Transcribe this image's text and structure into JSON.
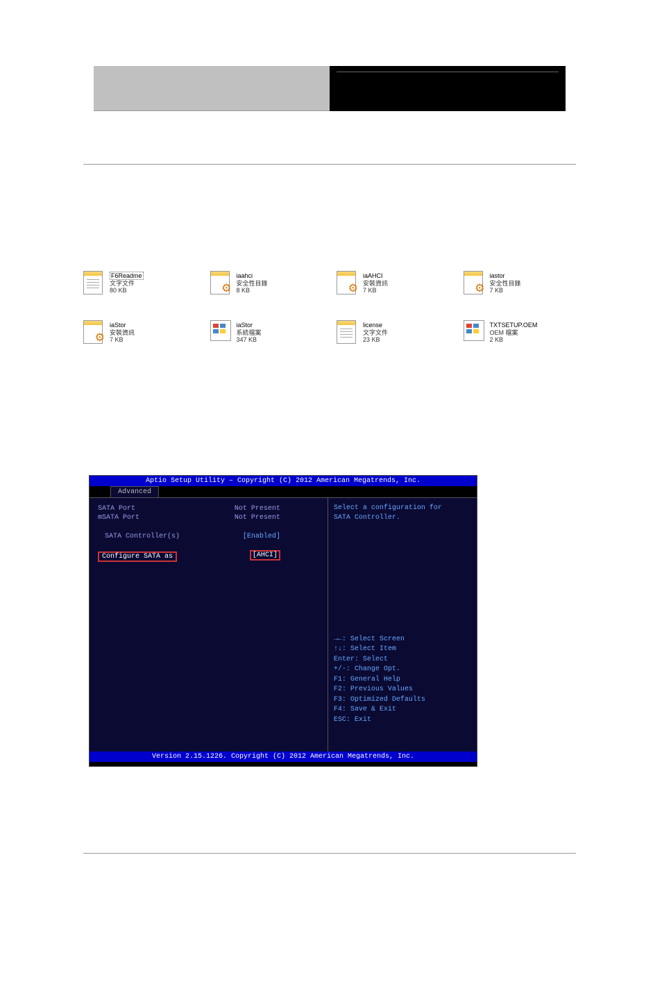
{
  "files": [
    {
      "name": "F6Readme",
      "type": "文字文件",
      "size": "80 KB",
      "icon": "text",
      "selected": true
    },
    {
      "name": "iaahci",
      "type": "安全性目錄",
      "size": "8 KB",
      "icon": "gear"
    },
    {
      "name": "iaAHCI",
      "type": "安裝資訊",
      "size": "7 KB",
      "icon": "text"
    },
    {
      "name": "iastor",
      "type": "安全性目錄",
      "size": "7 KB",
      "icon": "gear"
    },
    {
      "name": "iaStor",
      "type": "安裝資訊",
      "size": "7 KB",
      "icon": "gear"
    },
    {
      "name": "iaStor",
      "type": "系統檔案",
      "size": "347 KB",
      "icon": "sys"
    },
    {
      "name": "license",
      "type": "文字文件",
      "size": "23 KB",
      "icon": "text"
    },
    {
      "name": "TXTSETUP.OEM",
      "type": "OEM 檔案",
      "size": "2 KB",
      "icon": "sys"
    }
  ],
  "bios": {
    "header": "Aptio Setup Utility – Copyright (C) 2012 American Megatrends, Inc.",
    "tab": "Advanced",
    "rows": [
      {
        "label": "SATA Port",
        "value": "Not Present"
      },
      {
        "label": "mSATA Port",
        "value": "Not Present"
      }
    ],
    "controllers_label": "SATA Controller(s)",
    "controllers_value": "[Enabled]",
    "configure_label": "Configure SATA as",
    "configure_value": "[AHCI]",
    "help_line1": "Select a configuration for",
    "help_line2": "SATA Controller.",
    "nav": {
      "l1": "→←: Select Screen",
      "l2": "↑↓: Select Item",
      "l3": "Enter: Select",
      "l4": "+/-: Change Opt.",
      "l5": "F1: General Help",
      "l6": "F2: Previous Values",
      "l7": "F3: Optimized Defaults",
      "l8": "F4: Save & Exit",
      "l9": "ESC: Exit"
    },
    "footer": "Version 2.15.1226. Copyright (C) 2012 American Megatrends, Inc."
  }
}
